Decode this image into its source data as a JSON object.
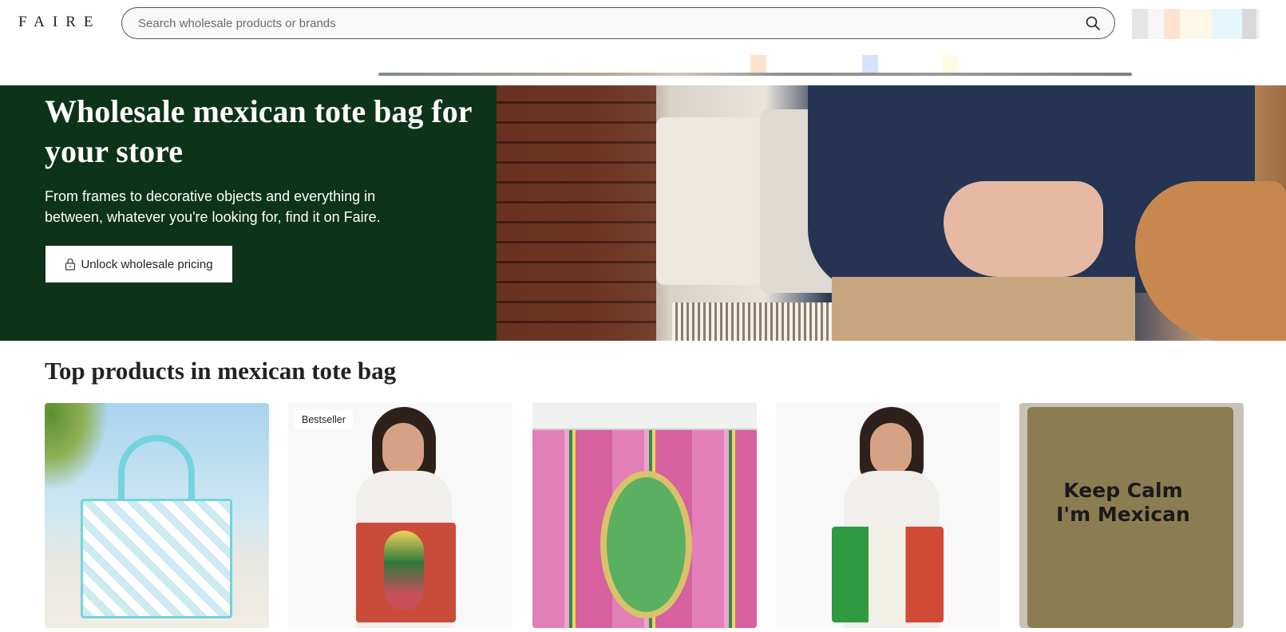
{
  "header": {
    "logo": "FAIRE",
    "search_placeholder": "Search wholesale products or brands"
  },
  "hero": {
    "title": "Wholesale mexican tote bag for your store",
    "subtitle": "From frames to decorative objects and everything in between, whatever you're looking for, find it on Faire.",
    "cta_label": "Unlock wholesale pricing"
  },
  "products_section": {
    "title": "Top products in mexican tote bag",
    "cards": [
      {
        "badge": ""
      },
      {
        "badge": "Bestseller"
      },
      {
        "badge": ""
      },
      {
        "badge": ""
      },
      {
        "badge": "",
        "image_text": "Keep Calm I'm Mexican"
      }
    ]
  },
  "colors": {
    "hero_green": "#0d3319",
    "accent": "#222222"
  }
}
